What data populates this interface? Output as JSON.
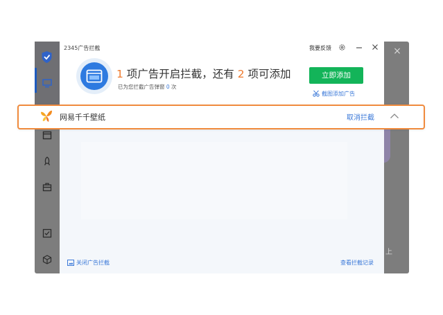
{
  "dialog": {
    "title": "2345广告拦截",
    "feedback": "我要反馈",
    "headline": {
      "count_blocked": "1",
      "blocked_text": " 项广告开启拦截，还有 ",
      "count_remaining": "2",
      "remaining_text": " 项可添加"
    },
    "stats": {
      "prefix": "已为您拦截广告弹窗 ",
      "count": "0",
      "suffix": " 次"
    },
    "add_button": "立即添加",
    "screenshot_add": "截图添加广告"
  },
  "row": {
    "app_name": "网易千千壁纸",
    "action": "取消拦截"
  },
  "footer": {
    "disable": "关闭广告拦截",
    "history": "查看拦截记录"
  },
  "background": {
    "side_text": "上"
  },
  "colors": {
    "accent_blue": "#3a78d8",
    "add_green": "#13b459",
    "highlight_orange": "#f08a3c",
    "count_orange": "#ef7a2e"
  }
}
